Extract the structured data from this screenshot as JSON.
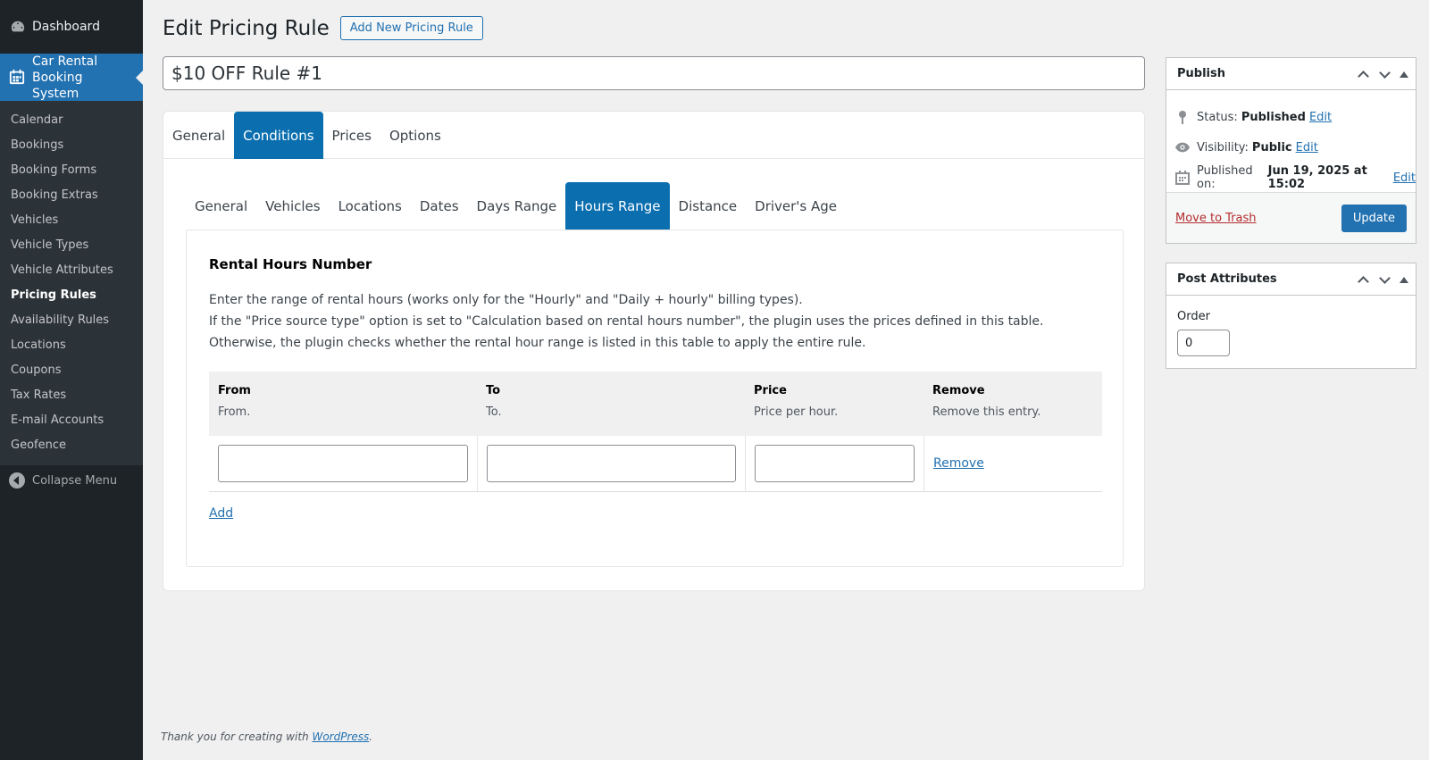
{
  "sidebar": {
    "dashboard": "Dashboard",
    "current_menu": "Car Rental Booking System",
    "items": [
      {
        "label": "Calendar"
      },
      {
        "label": "Bookings"
      },
      {
        "label": "Booking Forms"
      },
      {
        "label": "Booking Extras"
      },
      {
        "label": "Vehicles"
      },
      {
        "label": "Vehicle Types"
      },
      {
        "label": "Vehicle Attributes"
      },
      {
        "label": "Pricing Rules",
        "active": true
      },
      {
        "label": "Availability Rules"
      },
      {
        "label": "Locations"
      },
      {
        "label": "Coupons"
      },
      {
        "label": "Tax Rates"
      },
      {
        "label": "E-mail Accounts"
      },
      {
        "label": "Geofence"
      }
    ],
    "collapse": "Collapse Menu"
  },
  "header": {
    "title": "Edit Pricing Rule",
    "add_new": "Add New Pricing Rule",
    "post_title": "$10 OFF Rule #1"
  },
  "tabs_main": [
    "General",
    "Conditions",
    "Prices",
    "Options"
  ],
  "tabs_main_active": "Conditions",
  "tabs_sub": [
    "General",
    "Vehicles",
    "Locations",
    "Dates",
    "Days Range",
    "Hours Range",
    "Distance",
    "Driver's Age"
  ],
  "tabs_sub_active": "Hours Range",
  "section": {
    "heading": "Rental Hours Number",
    "desc": [
      "Enter the range of rental hours (works only for the \"Hourly\" and \"Daily + hourly\" billing types).",
      "If the \"Price source type\" option is set to \"Calculation based on rental hours number\", the plugin uses the prices defined in this table.",
      "Otherwise, the plugin checks whether the rental hour range is listed in this table to apply the entire rule."
    ]
  },
  "table": {
    "columns": [
      {
        "title": "From",
        "sub": "From."
      },
      {
        "title": "To",
        "sub": "To."
      },
      {
        "title": "Price",
        "sub": "Price per hour."
      },
      {
        "title": "Remove",
        "sub": "Remove this entry."
      }
    ],
    "row": {
      "from": "",
      "to": "",
      "price": "",
      "remove": "Remove"
    },
    "add": "Add"
  },
  "publish": {
    "title": "Publish",
    "status_label": "Status:",
    "status_value": "Published",
    "visibility_label": "Visibility:",
    "visibility_value": "Public",
    "published_label": "Published on:",
    "published_value": "Jun 19, 2025 at 15:02",
    "edit": "Edit",
    "trash": "Move to Trash",
    "update": "Update"
  },
  "post_attributes": {
    "title": "Post Attributes",
    "order_label": "Order",
    "order_value": "0"
  },
  "footer": {
    "text": "Thank you for creating with ",
    "link": "WordPress",
    "suffix": "."
  },
  "colors": {
    "accent": "#2271b1",
    "tab_active": "#0a6eaf",
    "sidebar_bg": "#1d2327",
    "trash": "#b32d2e"
  }
}
